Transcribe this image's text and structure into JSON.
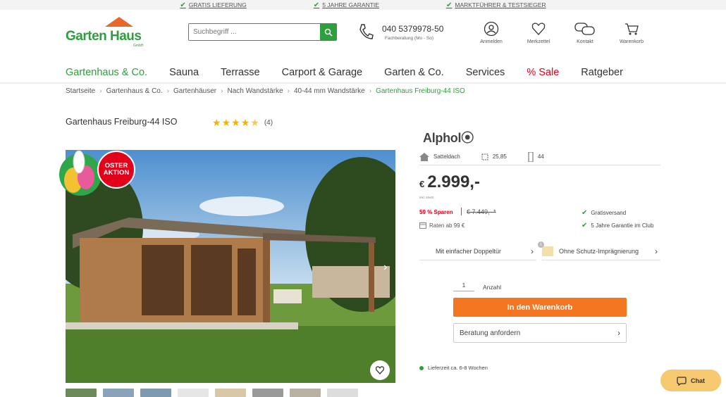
{
  "topbar": {
    "usps": [
      "GRATIS LIEFERUNG",
      "5 JAHRE GARANTIE",
      "MARKTFÜHRER & TESTSIEGER"
    ]
  },
  "header": {
    "logo_text": "Garten Haus",
    "logo_sub": "GmbH",
    "search_placeholder": "Suchbegriff ...",
    "phone_number": "040 5379978-50",
    "phone_sub": "Fachberatung (Mo - So)",
    "icons": [
      {
        "label": "Anmelden",
        "icon": "user-icon"
      },
      {
        "label": "Merkzettel",
        "icon": "heart-icon"
      },
      {
        "label": "Kontakt",
        "icon": "chat-bubbles-icon"
      },
      {
        "label": "Warenkorb",
        "icon": "cart-icon"
      }
    ]
  },
  "nav": [
    "Gartenhaus & Co.",
    "Sauna",
    "Terrasse",
    "Carport & Garage",
    "Garten & Co.",
    "Services",
    "% Sale",
    "Ratgeber"
  ],
  "breadcrumb": [
    "Startseite",
    "Gartenhaus & Co.",
    "Gartenhäuser",
    "Nach Wandstärke",
    "40-44 mm Wandstärke",
    "Gartenhaus Freiburg-44 ISO"
  ],
  "product": {
    "title": "Gartenhaus Freiburg-44 ISO",
    "rating_count": "(4)",
    "rating": 4.5,
    "badge": "OSTER AKTION",
    "brand": "Alphol",
    "specs": [
      {
        "label": "Satteldach",
        "icon": "roof-icon"
      },
      {
        "label": "25,85",
        "icon": "area-icon"
      },
      {
        "label": "44",
        "icon": "wall-icon"
      }
    ],
    "currency": "€",
    "price": "2.999,-",
    "inkl": "inkl. MwSt.",
    "save": "59 % Sparen",
    "old_price": "€ 7.449,- *",
    "raten": "Raten ab 99 €",
    "features": [
      "Gratisversand",
      "5 Jahre Garantie im Club"
    ],
    "option_door": "Mit einfacher Doppeltür",
    "option_impregnation": "Ohne Schutz-Imprägnierung",
    "qty": "1",
    "qty_label": "Anzahl",
    "cart_button": "In den Warenkorb",
    "advice_button": "Beratung anfordern",
    "delivery": "Lieferzeit ca. 6-8 Wochen"
  },
  "chat_label": "Chat"
}
